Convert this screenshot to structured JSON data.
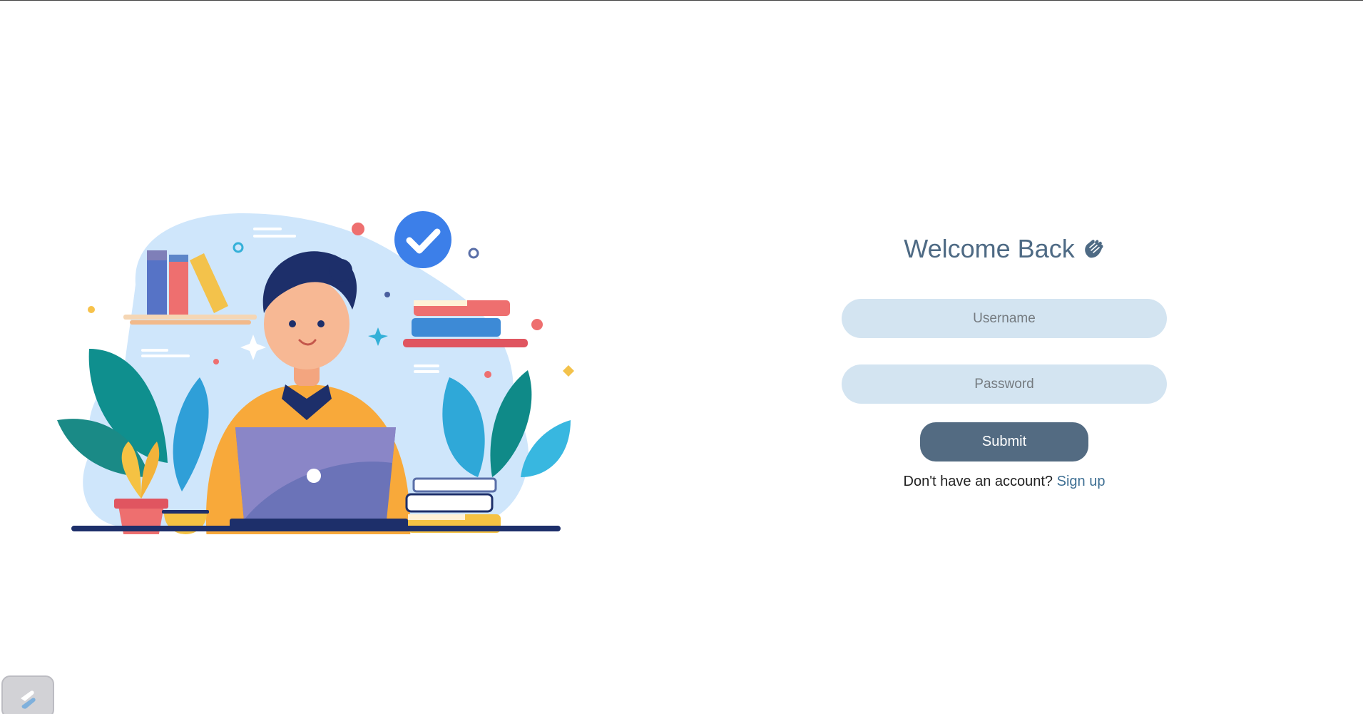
{
  "login": {
    "title": "Welcome Back",
    "title_icon": "waving-hand-icon",
    "username_placeholder": "Username",
    "password_placeholder": "Password",
    "submit_label": "Submit",
    "signup_prompt": "Don't have an account?",
    "signup_link": "Sign up"
  },
  "illustration": {
    "icon": "student-laptop-illustration"
  },
  "corner_badge": {
    "icon": "app-logo-icon"
  },
  "colors": {
    "title": "#4e6a84",
    "field_bg": "#d3e4f1",
    "button_bg": "#536b82",
    "link": "#3e6f93"
  }
}
